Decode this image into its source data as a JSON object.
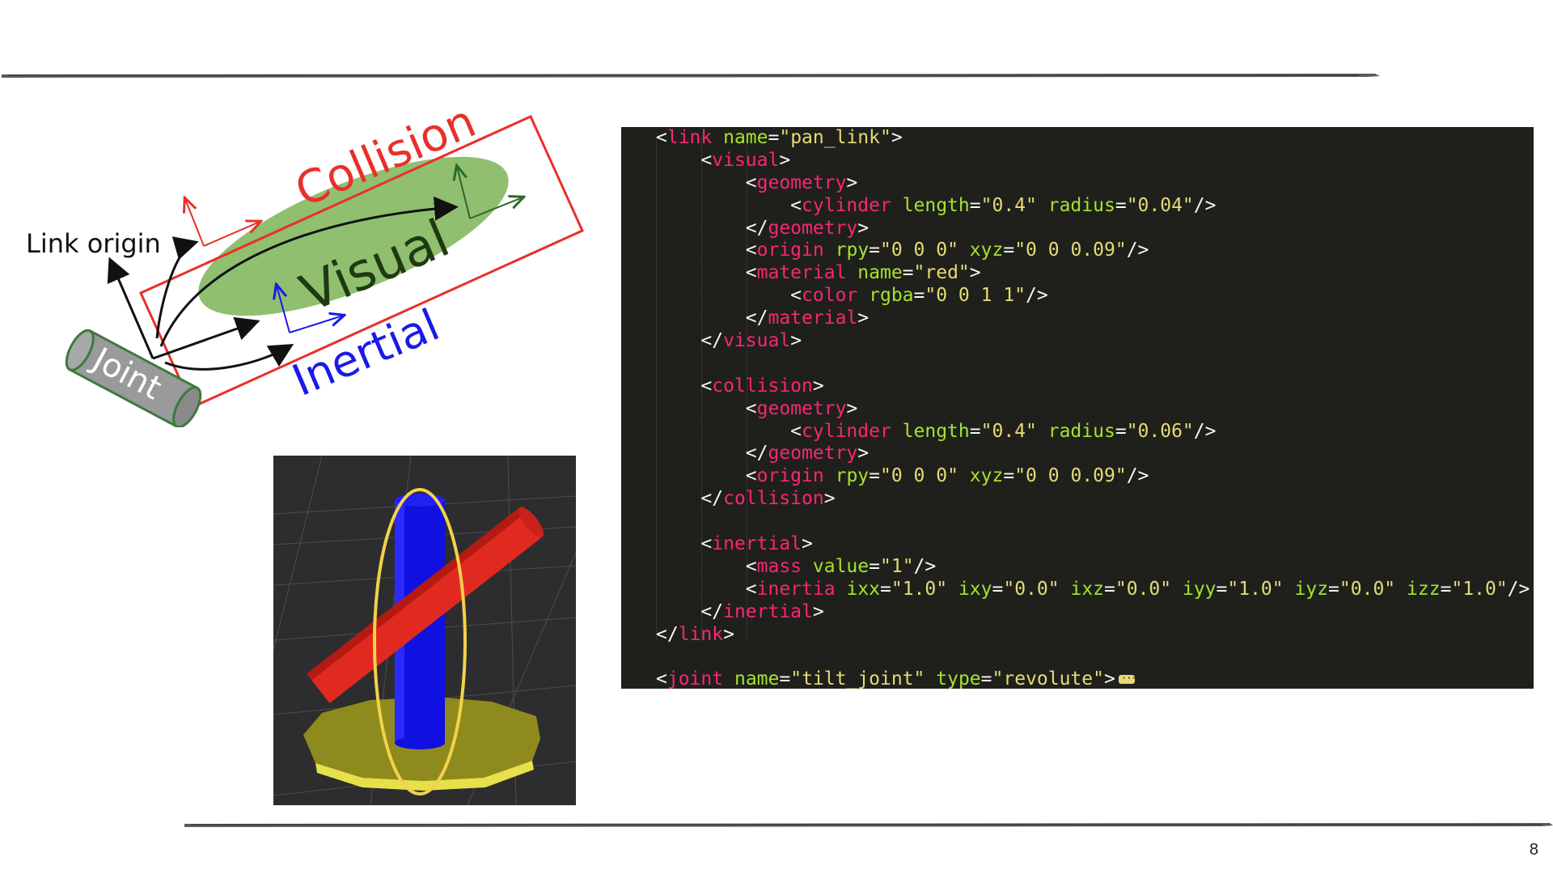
{
  "diagram": {
    "labels": {
      "collision": "Collision",
      "visual": "Visual",
      "inertial": "Inertial",
      "link_origin": "Link origin",
      "joint": "Joint"
    },
    "colors": {
      "collision": "#e8302a",
      "visual_fill": "#8fbf6f",
      "inertial": "#1a1ae6",
      "joint_fill": "#9a9a9a"
    }
  },
  "render": {
    "colors": {
      "background": "#2d2d2f",
      "base": "#8f8a1d",
      "cylinder": "#1010e0",
      "collision_bar": "#e02a20",
      "ellipse": "#f2d24a"
    }
  },
  "code": {
    "lines": [
      {
        "indent": 0,
        "tokens": [
          [
            "p",
            "<"
          ],
          [
            "tag",
            "link"
          ],
          [
            "p",
            " "
          ],
          [
            "attr",
            "name"
          ],
          [
            "p",
            "="
          ],
          [
            "val",
            "\"pan_link\""
          ],
          [
            "p",
            ">"
          ]
        ]
      },
      {
        "indent": 1,
        "tokens": [
          [
            "p",
            "<"
          ],
          [
            "tag",
            "visual"
          ],
          [
            "p",
            ">"
          ]
        ]
      },
      {
        "indent": 2,
        "tokens": [
          [
            "p",
            "<"
          ],
          [
            "tag",
            "geometry"
          ],
          [
            "p",
            ">"
          ]
        ]
      },
      {
        "indent": 3,
        "tokens": [
          [
            "p",
            "<"
          ],
          [
            "tag",
            "cylinder"
          ],
          [
            "p",
            " "
          ],
          [
            "attr",
            "length"
          ],
          [
            "p",
            "="
          ],
          [
            "val",
            "\"0.4\""
          ],
          [
            "p",
            " "
          ],
          [
            "attr",
            "radius"
          ],
          [
            "p",
            "="
          ],
          [
            "val",
            "\"0.04\""
          ],
          [
            "p",
            "/>"
          ]
        ]
      },
      {
        "indent": 2,
        "tokens": [
          [
            "p",
            "</"
          ],
          [
            "tag",
            "geometry"
          ],
          [
            "p",
            ">"
          ]
        ]
      },
      {
        "indent": 2,
        "tokens": [
          [
            "p",
            "<"
          ],
          [
            "tag",
            "origin"
          ],
          [
            "p",
            " "
          ],
          [
            "attr",
            "rpy"
          ],
          [
            "p",
            "="
          ],
          [
            "val",
            "\"0 0 0\""
          ],
          [
            "p",
            " "
          ],
          [
            "attr",
            "xyz"
          ],
          [
            "p",
            "="
          ],
          [
            "val",
            "\"0 0 0.09\""
          ],
          [
            "p",
            "/>"
          ]
        ]
      },
      {
        "indent": 2,
        "tokens": [
          [
            "p",
            "<"
          ],
          [
            "tag",
            "material"
          ],
          [
            "p",
            " "
          ],
          [
            "attr",
            "name"
          ],
          [
            "p",
            "="
          ],
          [
            "val",
            "\"red\""
          ],
          [
            "p",
            ">"
          ]
        ]
      },
      {
        "indent": 3,
        "tokens": [
          [
            "p",
            "<"
          ],
          [
            "tag",
            "color"
          ],
          [
            "p",
            " "
          ],
          [
            "attr",
            "rgba"
          ],
          [
            "p",
            "="
          ],
          [
            "val",
            "\"0 0 1 1\""
          ],
          [
            "p",
            "/>"
          ]
        ]
      },
      {
        "indent": 2,
        "tokens": [
          [
            "p",
            "</"
          ],
          [
            "tag",
            "material"
          ],
          [
            "p",
            ">"
          ]
        ]
      },
      {
        "indent": 1,
        "tokens": [
          [
            "p",
            "</"
          ],
          [
            "tag",
            "visual"
          ],
          [
            "p",
            ">"
          ]
        ]
      },
      {
        "indent": 0,
        "tokens": []
      },
      {
        "indent": 1,
        "tokens": [
          [
            "p",
            "<"
          ],
          [
            "tag",
            "collision"
          ],
          [
            "p",
            ">"
          ]
        ]
      },
      {
        "indent": 2,
        "tokens": [
          [
            "p",
            "<"
          ],
          [
            "tag",
            "geometry"
          ],
          [
            "p",
            ">"
          ]
        ]
      },
      {
        "indent": 3,
        "tokens": [
          [
            "p",
            "<"
          ],
          [
            "tag",
            "cylinder"
          ],
          [
            "p",
            " "
          ],
          [
            "attr",
            "length"
          ],
          [
            "p",
            "="
          ],
          [
            "val",
            "\"0.4\""
          ],
          [
            "p",
            " "
          ],
          [
            "attr",
            "radius"
          ],
          [
            "p",
            "="
          ],
          [
            "val",
            "\"0.06\""
          ],
          [
            "p",
            "/>"
          ]
        ]
      },
      {
        "indent": 2,
        "tokens": [
          [
            "p",
            "</"
          ],
          [
            "tag",
            "geometry"
          ],
          [
            "p",
            ">"
          ]
        ]
      },
      {
        "indent": 2,
        "tokens": [
          [
            "p",
            "<"
          ],
          [
            "tag",
            "origin"
          ],
          [
            "p",
            " "
          ],
          [
            "attr",
            "rpy"
          ],
          [
            "p",
            "="
          ],
          [
            "val",
            "\"0 0 0\""
          ],
          [
            "p",
            " "
          ],
          [
            "attr",
            "xyz"
          ],
          [
            "p",
            "="
          ],
          [
            "val",
            "\"0 0 0.09\""
          ],
          [
            "p",
            "/>"
          ]
        ]
      },
      {
        "indent": 1,
        "tokens": [
          [
            "p",
            "</"
          ],
          [
            "tag",
            "collision"
          ],
          [
            "p",
            ">"
          ]
        ]
      },
      {
        "indent": 0,
        "tokens": []
      },
      {
        "indent": 1,
        "tokens": [
          [
            "p",
            "<"
          ],
          [
            "tag",
            "inertial"
          ],
          [
            "p",
            ">"
          ]
        ]
      },
      {
        "indent": 2,
        "tokens": [
          [
            "p",
            "<"
          ],
          [
            "tag",
            "mass"
          ],
          [
            "p",
            " "
          ],
          [
            "attr",
            "value"
          ],
          [
            "p",
            "="
          ],
          [
            "val",
            "\"1\""
          ],
          [
            "p",
            "/>"
          ]
        ]
      },
      {
        "indent": 2,
        "tokens": [
          [
            "p",
            "<"
          ],
          [
            "tag",
            "inertia"
          ],
          [
            "p",
            " "
          ],
          [
            "attr",
            "ixx"
          ],
          [
            "p",
            "="
          ],
          [
            "val",
            "\"1.0\""
          ],
          [
            "p",
            " "
          ],
          [
            "attr",
            "ixy"
          ],
          [
            "p",
            "="
          ],
          [
            "val",
            "\"0.0\""
          ],
          [
            "p",
            " "
          ],
          [
            "attr",
            "ixz"
          ],
          [
            "p",
            "="
          ],
          [
            "val",
            "\"0.0\""
          ],
          [
            "p",
            " "
          ],
          [
            "attr",
            "iyy"
          ],
          [
            "p",
            "="
          ],
          [
            "val",
            "\"1.0\""
          ],
          [
            "p",
            " "
          ],
          [
            "attr",
            "iyz"
          ],
          [
            "p",
            "="
          ],
          [
            "val",
            "\"0.0\""
          ],
          [
            "p",
            " "
          ],
          [
            "attr",
            "izz"
          ],
          [
            "p",
            "="
          ],
          [
            "val",
            "\"1.0\""
          ],
          [
            "p",
            "/>"
          ]
        ]
      },
      {
        "indent": 1,
        "tokens": [
          [
            "p",
            "</"
          ],
          [
            "tag",
            "inertial"
          ],
          [
            "p",
            ">"
          ]
        ]
      },
      {
        "indent": 0,
        "tokens": [
          [
            "p",
            "</"
          ],
          [
            "tag",
            "link"
          ],
          [
            "p",
            ">"
          ]
        ]
      },
      {
        "indent": 0,
        "tokens": []
      },
      {
        "indent": 0,
        "tokens": [
          [
            "p",
            "<"
          ],
          [
            "tag",
            "joint"
          ],
          [
            "p",
            " "
          ],
          [
            "attr",
            "name"
          ],
          [
            "p",
            "="
          ],
          [
            "val",
            "\"tilt_joint\""
          ],
          [
            "p",
            " "
          ],
          [
            "attr",
            "type"
          ],
          [
            "p",
            "="
          ],
          [
            "val",
            "\"revolute\""
          ],
          [
            "p",
            ">"
          ]
        ],
        "folded": true
      }
    ]
  },
  "page_number": "8"
}
